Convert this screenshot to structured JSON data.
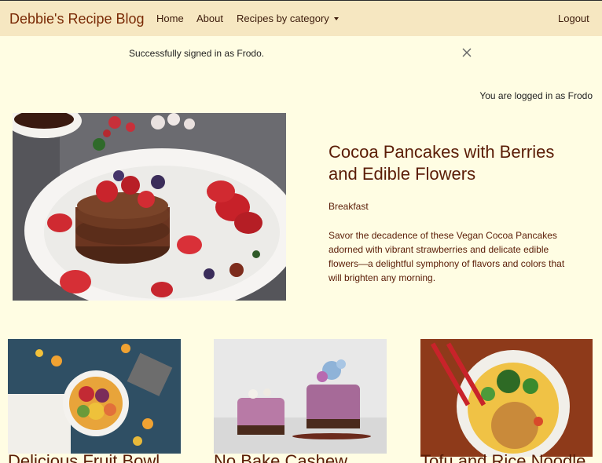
{
  "nav": {
    "brand": "Debbie's Recipe Blog",
    "links": [
      "Home",
      "About",
      "Recipes by category"
    ],
    "logout": "Logout"
  },
  "alert": {
    "message": "Successfully signed in as Frodo."
  },
  "status": {
    "logged_in": "You are logged in as Frodo"
  },
  "featured": {
    "title": "Cocoa Pancakes with Berries and Edible Flowers",
    "category": "Breakfast",
    "description": "Savor the decadence of these Vegan Cocoa Pancakes adorned with vibrant strawberries and delicate edible flowers—a delightful symphony of flavors and colors that will brighten any morning."
  },
  "cards": [
    {
      "title": "Delicious Fruit Bowl"
    },
    {
      "title": "No Bake Cashew"
    },
    {
      "title": "Tofu and Rice Noodle"
    }
  ]
}
